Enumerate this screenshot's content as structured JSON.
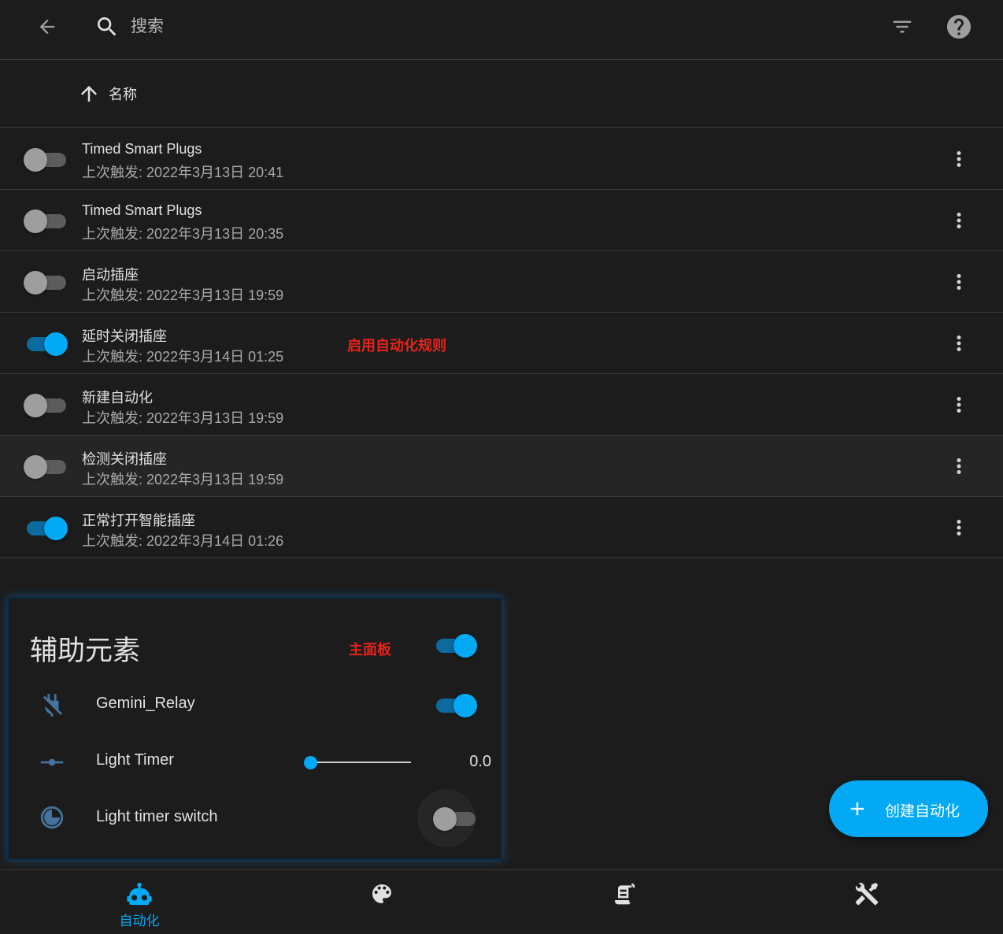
{
  "header": {
    "search_placeholder": "搜索"
  },
  "sort": {
    "label": "名称"
  },
  "automations": [
    {
      "name": "Timed Smart Plugs",
      "last_triggered": "上次触发: 2022年3月13日 20:41",
      "enabled": false
    },
    {
      "name": "Timed Smart Plugs",
      "last_triggered": "上次触发: 2022年3月13日 20:35",
      "enabled": false
    },
    {
      "name": "启动插座",
      "last_triggered": "上次触发: 2022年3月13日 19:59",
      "enabled": false
    },
    {
      "name": "延时关闭插座",
      "last_triggered": "上次触发: 2022年3月14日 01:25",
      "enabled": true
    },
    {
      "name": "新建自动化",
      "last_triggered": "上次触发: 2022年3月13日 19:59",
      "enabled": false
    },
    {
      "name": "检测关闭插座",
      "last_triggered": "上次触发: 2022年3月13日 19:59",
      "enabled": false
    },
    {
      "name": "正常打开智能插座",
      "last_triggered": "上次触发: 2022年3月14日 01:26",
      "enabled": true
    }
  ],
  "annotations": {
    "enable_rule": "启用自动化规则",
    "main_panel": "主面板"
  },
  "helpers_card": {
    "title": "辅助元素",
    "header_toggle_on": true,
    "entities": [
      {
        "name": "Gemini_Relay",
        "icon": "power-plug-off-icon",
        "type": "switch",
        "on": true
      },
      {
        "name": "Light Timer",
        "icon": "ray-vertex-icon",
        "type": "slider",
        "value": "0.0",
        "fraction": 0.0
      },
      {
        "name": "Light timer switch",
        "icon": "timer-icon",
        "type": "switch",
        "on": false
      }
    ]
  },
  "fab": {
    "label": "创建自动化"
  },
  "bottom_nav": [
    {
      "name": "自动化",
      "icon": "robot-icon",
      "active": true
    },
    {
      "name": "",
      "icon": "palette-icon",
      "active": false
    },
    {
      "name": "",
      "icon": "script-text-icon",
      "active": false
    },
    {
      "name": "",
      "icon": "tools-icon",
      "active": false
    }
  ],
  "colors": {
    "accent": "#03a9f4",
    "background": "#1c1c1c",
    "annotation_red": "#e5231b"
  }
}
